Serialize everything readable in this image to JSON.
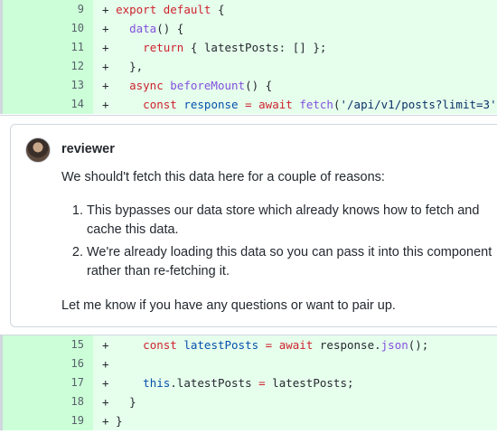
{
  "diff_top": [
    {
      "num": "9",
      "sign": "+",
      "parts": [
        [
          "",
          " "
        ],
        [
          "kw",
          "export"
        ],
        [
          "",
          " "
        ],
        [
          "kw",
          "default"
        ],
        [
          "",
          " {"
        ]
      ]
    },
    {
      "num": "10",
      "sign": "+",
      "parts": [
        [
          "",
          "   "
        ],
        [
          "fn",
          "data"
        ],
        [
          "",
          "() {"
        ]
      ]
    },
    {
      "num": "11",
      "sign": "+",
      "parts": [
        [
          "",
          "     "
        ],
        [
          "kw",
          "return"
        ],
        [
          "",
          " { latestPosts: [] };"
        ]
      ]
    },
    {
      "num": "12",
      "sign": "+",
      "parts": [
        [
          "",
          "   },"
        ]
      ]
    },
    {
      "num": "13",
      "sign": "+",
      "parts": [
        [
          "",
          "   "
        ],
        [
          "kw",
          "async"
        ],
        [
          "",
          " "
        ],
        [
          "fn",
          "beforeMount"
        ],
        [
          "",
          "() {"
        ]
      ]
    },
    {
      "num": "14",
      "sign": "+",
      "parts": [
        [
          "",
          "     "
        ],
        [
          "kw",
          "const"
        ],
        [
          "",
          " "
        ],
        [
          "ent",
          "response"
        ],
        [
          "",
          " "
        ],
        [
          "kw",
          "="
        ],
        [
          "",
          " "
        ],
        [
          "kw",
          "await"
        ],
        [
          "",
          " "
        ],
        [
          "fn",
          "fetch"
        ],
        [
          "",
          "("
        ],
        [
          "str",
          "'/api/v1/posts?limit=3'"
        ],
        [
          "",
          ");"
        ]
      ]
    }
  ],
  "comment": {
    "author": "reviewer",
    "intro": "We should't fetch this data here for a couple of reasons:",
    "reasons": [
      "This bypasses our data store which already knows how to fetch and cache this data.",
      "We're already loading this data so you can pass it into this component rather than re-fetching it."
    ],
    "closing": "Let me know if you have any questions or want to pair up."
  },
  "diff_bottom": [
    {
      "num": "15",
      "sign": "+",
      "parts": [
        [
          "",
          "     "
        ],
        [
          "kw",
          "const"
        ],
        [
          "",
          " "
        ],
        [
          "ent",
          "latestPosts"
        ],
        [
          "",
          " "
        ],
        [
          "kw",
          "="
        ],
        [
          "",
          " "
        ],
        [
          "kw",
          "await"
        ],
        [
          "",
          " response."
        ],
        [
          "fn",
          "json"
        ],
        [
          "",
          "();"
        ]
      ]
    },
    {
      "num": "16",
      "sign": "+",
      "parts": [
        [
          "",
          ""
        ]
      ]
    },
    {
      "num": "17",
      "sign": "+",
      "parts": [
        [
          "",
          "     "
        ],
        [
          "ent",
          "this"
        ],
        [
          "",
          ".latestPosts "
        ],
        [
          "kw",
          "="
        ],
        [
          "",
          " latestPosts;"
        ]
      ]
    },
    {
      "num": "18",
      "sign": "+",
      "parts": [
        [
          "",
          "   }"
        ]
      ]
    },
    {
      "num": "19",
      "sign": "+",
      "parts": [
        [
          "",
          " }"
        ]
      ]
    }
  ],
  "colors": {
    "addition_bg": "#e6ffec",
    "addition_gutter_bg": "#ccffd8",
    "keyword": "#cf222e",
    "function": "#8250df",
    "entity": "#0550ae",
    "string": "#0a3069"
  }
}
